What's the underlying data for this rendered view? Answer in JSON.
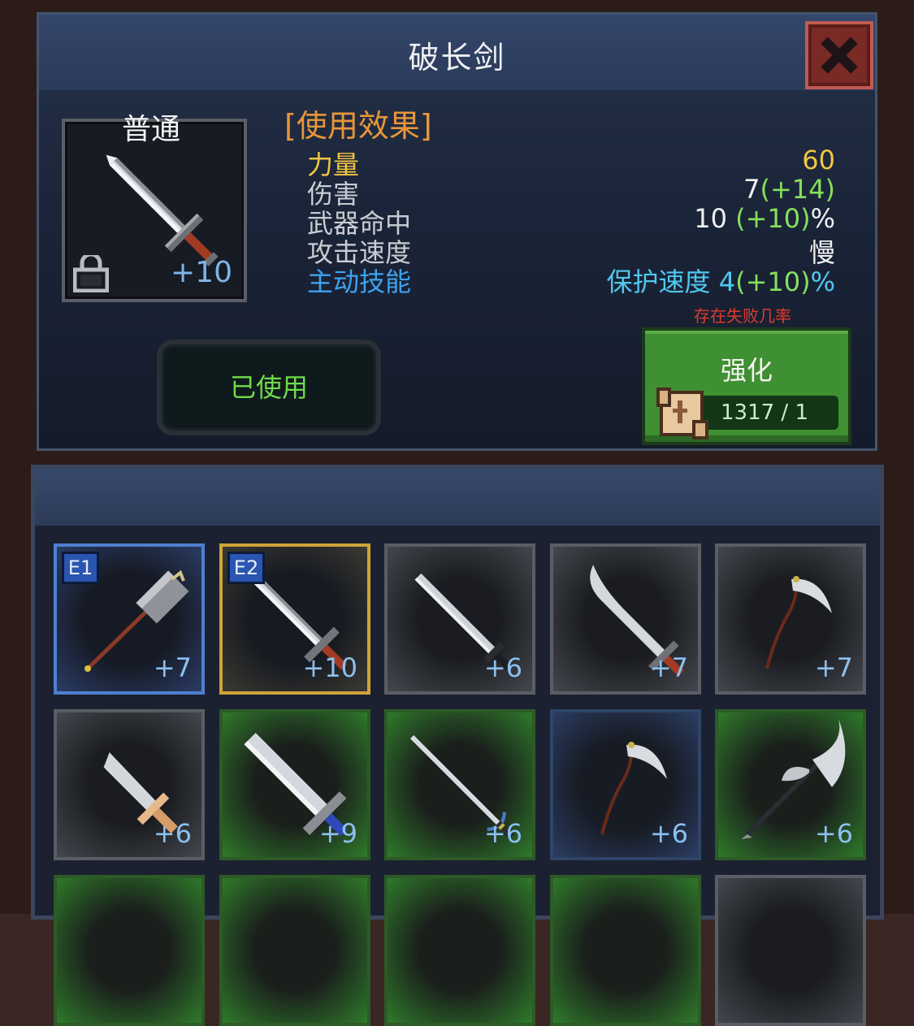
{
  "detail": {
    "title": "破长剑",
    "rarity": "普通",
    "item_plus": "+10",
    "effects_heading": "[使用效果]",
    "stats": [
      {
        "label": "力量",
        "value_parts": [
          {
            "text": "60",
            "color": "#f2c544"
          }
        ],
        "label_color": "#f2c544"
      },
      {
        "label": "伤害",
        "value_parts": [
          {
            "text": "7",
            "color": "#f0f0f0"
          },
          {
            "text": "(+14)",
            "color": "#86e05c"
          }
        ],
        "label_color": "#c9ccd2"
      },
      {
        "label": "武器命中",
        "value_parts": [
          {
            "text": "10 ",
            "color": "#f0f0f0"
          },
          {
            "text": "(+10)",
            "color": "#86e05c"
          },
          {
            "text": "%",
            "color": "#f0f0f0"
          }
        ],
        "label_color": "#c9ccd2"
      },
      {
        "label": "攻击速度",
        "value_parts": [
          {
            "text": "慢",
            "color": "#f0f0f0"
          }
        ],
        "label_color": "#c9ccd2"
      },
      {
        "label": "主动技能",
        "value_parts": [
          {
            "text": "保护速度 ",
            "color": "#4fc8f0"
          },
          {
            "text": "4",
            "color": "#4fc8f0"
          },
          {
            "text": "(+10)",
            "color": "#86e05c"
          },
          {
            "text": "%",
            "color": "#4fc8f0"
          }
        ],
        "label_color": "#3fa2ee"
      }
    ],
    "fail_warning": "存在失败几率",
    "used_button": "已使用",
    "enhance_button": "强化",
    "enhance_count": "1317 / 1"
  },
  "inventory": {
    "slots": [
      {
        "weapon": "hammer",
        "plus": "+7",
        "badge": "E1",
        "style": "equip1"
      },
      {
        "weapon": "longsword",
        "plus": "+10",
        "badge": "E2",
        "style": "equip2"
      },
      {
        "weapon": "straight-sword",
        "plus": "+6",
        "badge": "",
        "style": "gray"
      },
      {
        "weapon": "scimitar",
        "plus": "+7",
        "badge": "",
        "style": "gray"
      },
      {
        "weapon": "scythe",
        "plus": "+7",
        "badge": "",
        "style": "gray"
      },
      {
        "weapon": "dagger",
        "plus": "+6",
        "badge": "",
        "style": "gray"
      },
      {
        "weapon": "broadsword",
        "plus": "+9",
        "badge": "",
        "style": "green"
      },
      {
        "weapon": "rapier",
        "plus": "+6",
        "badge": "",
        "style": "green"
      },
      {
        "weapon": "scythe",
        "plus": "+6",
        "badge": "",
        "style": "blue"
      },
      {
        "weapon": "battle-axe",
        "plus": "+6",
        "badge": "",
        "style": "green"
      }
    ],
    "partial_row_styles": [
      "green",
      "green",
      "green",
      "green",
      "gray"
    ]
  }
}
